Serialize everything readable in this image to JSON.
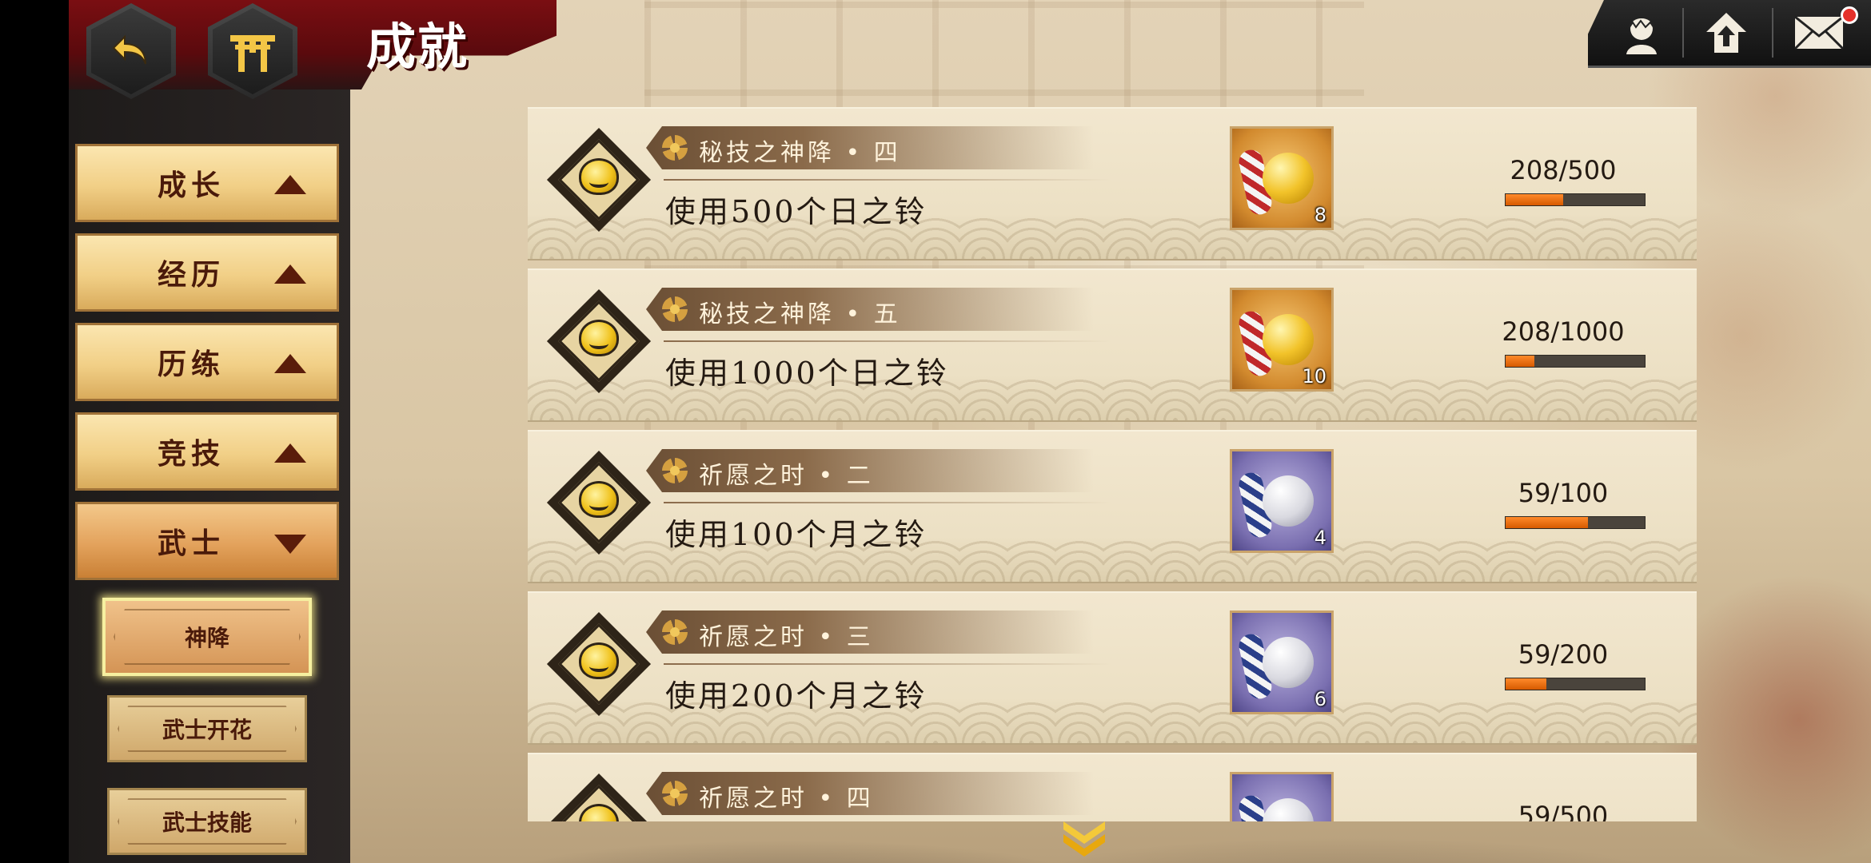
{
  "header": {
    "title": "成就"
  },
  "sidebar": {
    "categories": [
      {
        "label": "成长",
        "state": "collapsed"
      },
      {
        "label": "经历",
        "state": "collapsed"
      },
      {
        "label": "历练",
        "state": "collapsed"
      },
      {
        "label": "竞技",
        "state": "collapsed"
      },
      {
        "label": "武士",
        "state": "expanded"
      }
    ],
    "subcategories": [
      {
        "label": "神降",
        "selected": true
      },
      {
        "label": "武士开花",
        "selected": false
      },
      {
        "label": "武士技能",
        "selected": false
      }
    ]
  },
  "achievements": [
    {
      "name": "秘技之神降 • 四",
      "description": "使用500个日之铃",
      "reward_icon": "sun-bell-icon",
      "reward_count": "8",
      "progress_text": "208/500",
      "progress": 0.416
    },
    {
      "name": "秘技之神降 • 五",
      "description": "使用1000个日之铃",
      "reward_icon": "sun-bell-icon",
      "reward_count": "10",
      "progress_text": "208/1000",
      "progress": 0.208
    },
    {
      "name": "祈愿之时 • 二",
      "description": "使用100个月之铃",
      "reward_icon": "moon-bell-icon",
      "reward_count": "4",
      "progress_text": "59/100",
      "progress": 0.59
    },
    {
      "name": "祈愿之时 • 三",
      "description": "使用200个月之铃",
      "reward_icon": "moon-bell-icon",
      "reward_count": "6",
      "progress_text": "59/200",
      "progress": 0.295
    },
    {
      "name": "祈愿之时 • 四",
      "description": "",
      "reward_icon": "moon-bell-icon",
      "reward_count": "",
      "progress_text": "59/500",
      "progress": 0.118
    }
  ],
  "colors": {
    "progress_fill": "#e86b10",
    "header_red": "#7a0e12",
    "notification": "#e5302a"
  },
  "icons": {
    "back": "back-arrow-icon",
    "home": "torii-gate-icon",
    "profile": "character-icon",
    "upgrade": "level-up-house-icon",
    "mail": "mail-icon",
    "scroll": "double-chevron-down-icon"
  }
}
